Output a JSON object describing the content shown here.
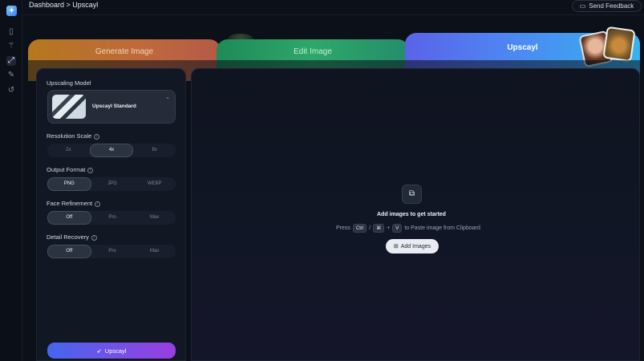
{
  "header": {
    "breadcrumb": "Dashboard > Upscayl",
    "feedback_label": "Send Feedback"
  },
  "rail": {
    "icons": [
      "app-logo-icon",
      "book-icon",
      "wand-icon",
      "upscale-icon",
      "edit-icon",
      "history-icon"
    ]
  },
  "tabs": [
    {
      "label": "Generate Image"
    },
    {
      "label": "Edit Image"
    },
    {
      "label": "Upscayl"
    }
  ],
  "sidebar": {
    "model_label": "Upscaling Model",
    "model_name": "Upscayl Standard",
    "resolution_label": "Resolution Scale",
    "resolution_options": [
      "2x",
      "4x",
      "8x"
    ],
    "resolution_selected": "4x",
    "format_label": "Output Format",
    "format_options": [
      "PNG",
      "JPG",
      "WEBP"
    ],
    "format_selected": "PNG",
    "face_label": "Face Refinement",
    "face_options": [
      "Off",
      "Pro",
      "Max"
    ],
    "face_selected": "Off",
    "detail_label": "Detail Recovery",
    "detail_options": [
      "Off",
      "Pro",
      "Max"
    ],
    "detail_selected": "Off",
    "upscayl_button": "Upscayl"
  },
  "main": {
    "empty_title": "Add images to get started",
    "empty_prefix": "Press",
    "key_ctrl": "Ctrl",
    "slash": "/",
    "key_cmd": "⌘",
    "plus": "+",
    "key_v": "V",
    "empty_suffix": "to Paste image from Clipboard",
    "add_button": "Add Images"
  },
  "colors": {
    "background": "#0c1019",
    "accent_start": "#4466ee",
    "accent_end": "#9a3de0"
  }
}
